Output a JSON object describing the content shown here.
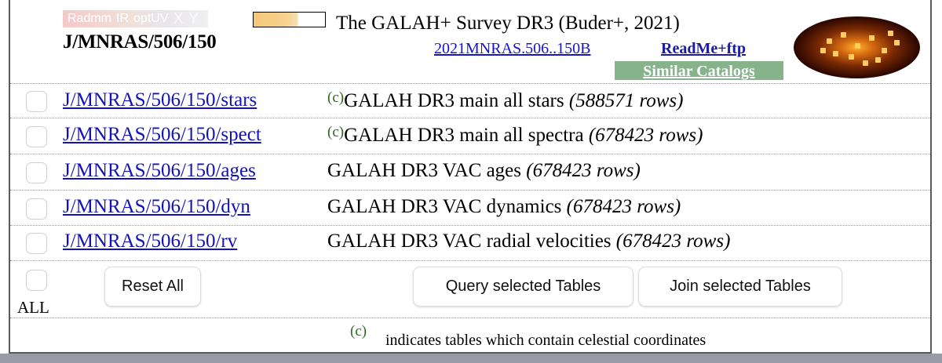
{
  "header": {
    "wavebands": [
      "Radmm",
      "IR",
      "optUV",
      "X",
      "Y"
    ],
    "catalog_id": "J/MNRAS/506/150",
    "title": "The GALAH+ Survey DR3 (Buder+, 2021)",
    "bibcode": "2021MNRAS.506..150B",
    "readme_link": "ReadMe+ftp",
    "similar_link": "Similar Catalogs"
  },
  "tables": [
    {
      "name": "J/MNRAS/506/150/stars",
      "celestial": true,
      "marker": "(c)",
      "description": "GALAH DR3 main all stars",
      "rows": "(588571 rows)"
    },
    {
      "name": "J/MNRAS/506/150/spect",
      "celestial": true,
      "marker": "(c)",
      "description": "GALAH DR3 main all spectra",
      "rows": "(678423 rows)"
    },
    {
      "name": "J/MNRAS/506/150/ages",
      "celestial": false,
      "marker": "",
      "description": "GALAH DR3 VAC ages",
      "rows": "(678423 rows)"
    },
    {
      "name": "J/MNRAS/506/150/dyn",
      "celestial": false,
      "marker": "",
      "description": "GALAH DR3 VAC dynamics",
      "rows": "(678423 rows)"
    },
    {
      "name": "J/MNRAS/506/150/rv",
      "celestial": false,
      "marker": "",
      "description": "GALAH DR3 VAC radial velocities",
      "rows": "(678423 rows)"
    }
  ],
  "controls": {
    "all_label": "ALL",
    "reset_button": "Reset All",
    "query_button": "Query selected Tables",
    "join_button": "Join selected Tables"
  },
  "footnote": {
    "marker": "(c)",
    "text": "indicates tables which contain celestial coordinates"
  },
  "colors": {
    "link": "#1212b8",
    "similar_bg": "#86b38c",
    "celestial_marker": "#2e6a1e"
  }
}
